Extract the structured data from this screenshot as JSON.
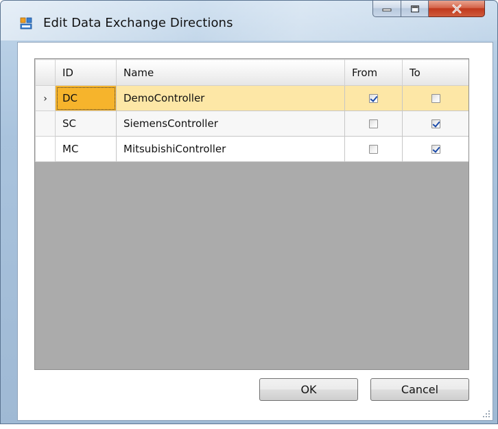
{
  "window": {
    "title": "Edit Data Exchange Directions",
    "icon": "app-window-icon",
    "caption_buttons": [
      "minimize-icon",
      "maximize-icon",
      "close-icon"
    ],
    "colors": {
      "frame": "#b9d0e6",
      "close": "#c0391d",
      "selected_row": "#fde7a6",
      "selected_cell": "#f6b42c"
    }
  },
  "grid": {
    "columns": [
      "ID",
      "Name",
      "From",
      "To"
    ],
    "current_row": 0,
    "rows": [
      {
        "id": "DC",
        "name": "DemoController",
        "from": true,
        "to": false
      },
      {
        "id": "SC",
        "name": "SiemensController",
        "from": false,
        "to": true
      },
      {
        "id": "MC",
        "name": "MitsubishiController",
        "from": false,
        "to": true
      }
    ],
    "row_indicator": "›"
  },
  "buttons": {
    "ok": "OK",
    "cancel": "Cancel"
  }
}
